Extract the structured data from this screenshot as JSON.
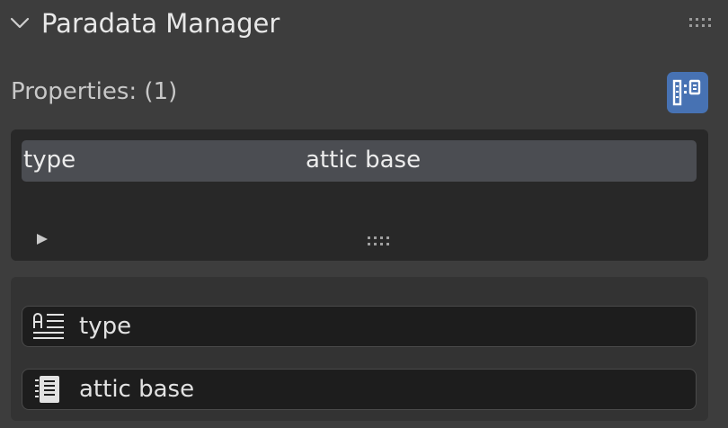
{
  "panel": {
    "title": "Paradata Manager",
    "properties_label": "Properties: (1)"
  },
  "list": {
    "rows": [
      {
        "key": "type",
        "value": "attic base"
      }
    ]
  },
  "details": {
    "name_value": "type",
    "value_value": "attic base"
  },
  "icons": {
    "collapse": "chevron-down-icon",
    "drag": "drag-handle-icon",
    "list_toggle": "list-view-icon",
    "expand": "play-triangle-icon",
    "resize": "resize-grip-icon",
    "name_field": "text-field-icon",
    "value_field": "document-icon"
  },
  "colors": {
    "background": "#3d3d3d",
    "accent": "#4772b3",
    "selected_row": "#4b4d52",
    "list_bg": "#282828",
    "field_bg": "#1d1d1d"
  }
}
